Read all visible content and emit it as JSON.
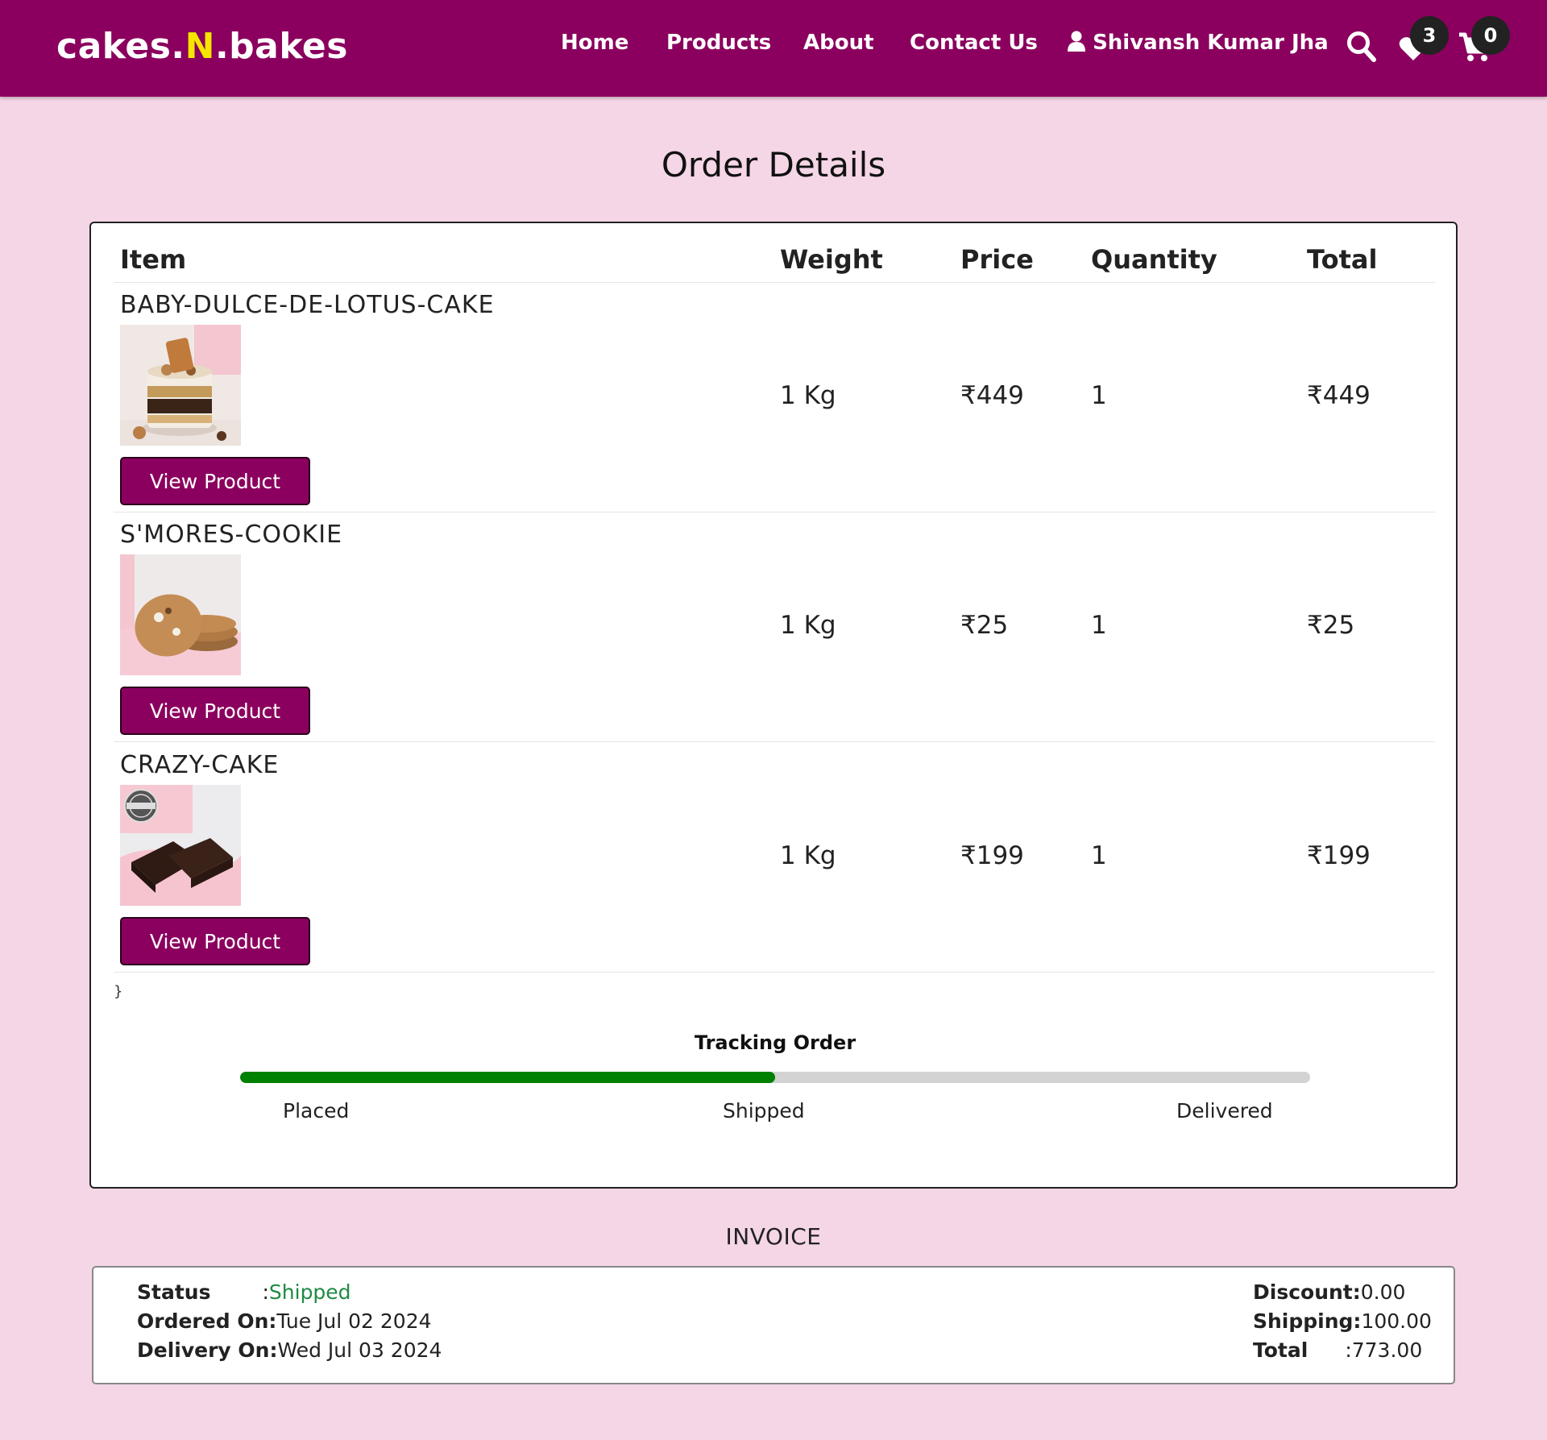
{
  "brand": {
    "part1": "cakes.",
    "accent": "N",
    "part2": ".bakes"
  },
  "nav": {
    "home": "Home",
    "products": "Products",
    "about": "About",
    "contact": "Contact Us",
    "user": "Shivansh Kumar Jha",
    "wishlist_count": "3",
    "cart_count": "0"
  },
  "page_title": "Order Details",
  "table": {
    "headers": {
      "item": "Item",
      "weight": "Weight",
      "price": "Price",
      "quantity": "Quantity",
      "total": "Total"
    },
    "rows": [
      {
        "name": "BABY-DULCE-DE-LOTUS-CAKE",
        "weight": "1 Kg",
        "price": "₹449",
        "quantity": "1",
        "total": "₹449",
        "button": "View Product"
      },
      {
        "name": "S'MORES-COOKIE",
        "weight": "1 Kg",
        "price": "₹25",
        "quantity": "1",
        "total": "₹25",
        "button": "View Product"
      },
      {
        "name": "CRAZY-CAKE",
        "weight": "1 Kg",
        "price": "₹199",
        "quantity": "1",
        "total": "₹199",
        "button": "View Product"
      }
    ],
    "stray_text": "}"
  },
  "tracking": {
    "title": "Tracking Order",
    "progress_percent": 50,
    "steps": [
      "Placed",
      "Shipped",
      "Delivered"
    ],
    "fill_color": "#008000"
  },
  "invoice": {
    "title": "INVOICE",
    "status_label": "Status",
    "status_sep": ":",
    "status_value": "Shipped",
    "ordered_label": "Ordered On:",
    "ordered_value": "Tue Jul 02 2024",
    "delivery_label": "Delivery On:",
    "delivery_value": "Wed Jul 03 2024",
    "discount_label": "Discount:",
    "discount_value": "0.00",
    "shipping_label": "Shipping:",
    "shipping_value": "100.00",
    "total_label": "Total",
    "total_sep": ":",
    "total_value": "773.00"
  },
  "colors": {
    "brand": "#8b005e",
    "background": "#f5d6e6",
    "accent": "#f5e600",
    "status": "#1f8a43"
  },
  "icons": [
    "user-icon",
    "search-icon",
    "heart-icon",
    "cart-icon"
  ]
}
